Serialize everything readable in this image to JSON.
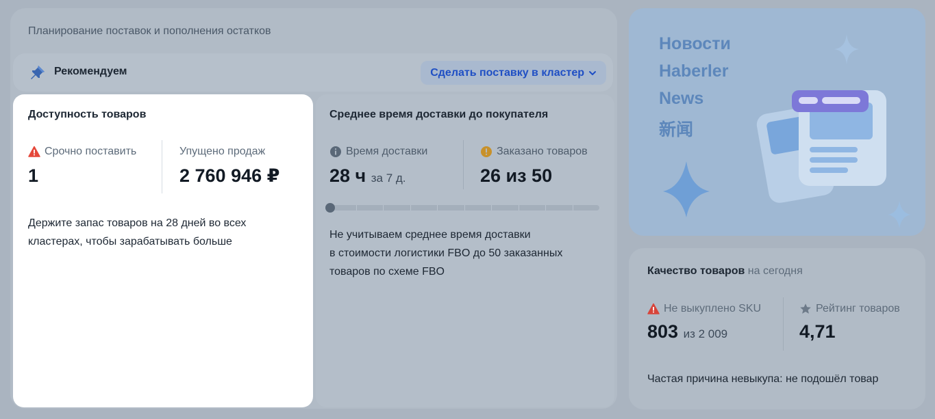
{
  "planning": {
    "title": "Планирование поставок и пополнения остатков",
    "recommend_label": "Рекомендуем",
    "supply_button": "Сделать поставку в кластер"
  },
  "availability": {
    "title": "Доступность товаров",
    "urgent_label": "Срочно поставить",
    "urgent_value": "1",
    "lost_label": "Упущено продаж",
    "lost_value": "2 760 946 ₽",
    "description_line1": "Держите запас товаров на 28 дней во всех",
    "description_line2": "кластерах, чтобы зарабатывать больше"
  },
  "delivery": {
    "title": "Среднее время доставки до покупателя",
    "time_label": "Время доставки",
    "time_value": "28 ч",
    "time_period": "за 7 д.",
    "ordered_label": "Заказано товаров",
    "ordered_value": "26 из 50",
    "progress_fraction": 0,
    "description_line1": "Не учитываем среднее время доставки",
    "description_line2": "в стоимости логистики FBO до 50 заказанных",
    "description_line3": "товаров по схеме FBO"
  },
  "news": {
    "lines": [
      "Новости",
      "Haberler",
      "News",
      "新闻"
    ]
  },
  "quality": {
    "title": "Качество товаров",
    "title_suffix": "на сегодня",
    "unbought_label": "Не выкуплено SKU",
    "unbought_value": "803",
    "unbought_total": "из 2 009",
    "rating_label": "Рейтинг товаров",
    "rating_value": "4,71",
    "reason": "Частая причина невыкупа: не подошёл товар"
  },
  "colors": {
    "warning_red": "#e5483a",
    "warning_orange": "#c8912a",
    "accent_blue": "#1f4fc4",
    "info_gray": "#5a6878"
  }
}
